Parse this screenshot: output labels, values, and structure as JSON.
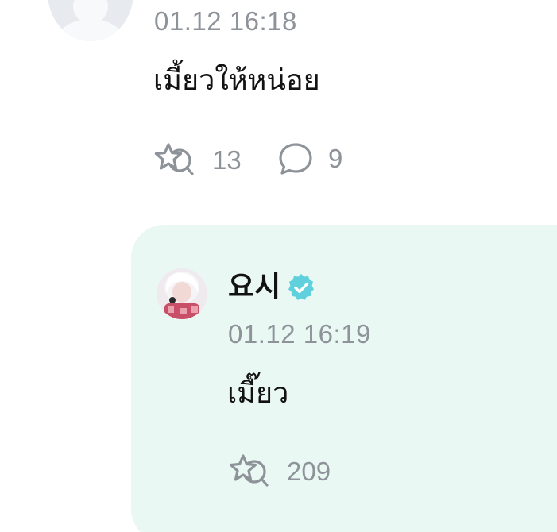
{
  "comments": [
    {
      "timestamp": "01.12 16:18",
      "text": "เมี้ยวให้หน่อย",
      "like_count": "13",
      "reply_count": "9"
    }
  ],
  "reply": {
    "author_name": "요시",
    "verified": true,
    "timestamp": "01.12 16:19",
    "text": "เมี๊ยว",
    "like_count": "209"
  },
  "colors": {
    "reply_background": "#eaf8f4",
    "verified_badge": "#5fd0dc",
    "meta_text": "#8e939a",
    "body_text": "#121212"
  },
  "icons": [
    "default-avatar-icon",
    "like-icon",
    "comment-icon",
    "verified-badge-icon"
  ]
}
